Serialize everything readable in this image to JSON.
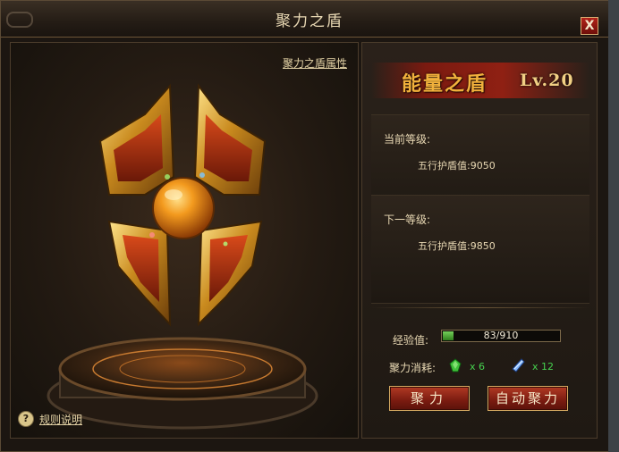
{
  "window": {
    "title": "聚力之盾",
    "close_label": "X"
  },
  "left": {
    "attr_link": "聚力之盾属性",
    "rules_icon": "?",
    "rules_label": "规则说明"
  },
  "right": {
    "banner_title": "能量之盾",
    "banner_level": "Lv.20",
    "current": {
      "heading": "当前等级:",
      "value": "五行护盾值:9050"
    },
    "next": {
      "heading": "下一等级:",
      "value": "五行护盾值:9850"
    },
    "exp": {
      "label": "经验值:",
      "text": "83/910",
      "current": 83,
      "max": 910
    },
    "cost": {
      "label": "聚力消耗:",
      "items": [
        {
          "icon": "green-gem-icon",
          "count": "x 6"
        },
        {
          "icon": "blue-crystal-icon",
          "count": "x 12"
        }
      ]
    },
    "buttons": {
      "gather": "聚力",
      "auto_gather": "自动聚力"
    }
  },
  "colors": {
    "accent_gold": "#f1b13c",
    "button_red": "#9a2a18",
    "exp_green": "#46d14f"
  }
}
